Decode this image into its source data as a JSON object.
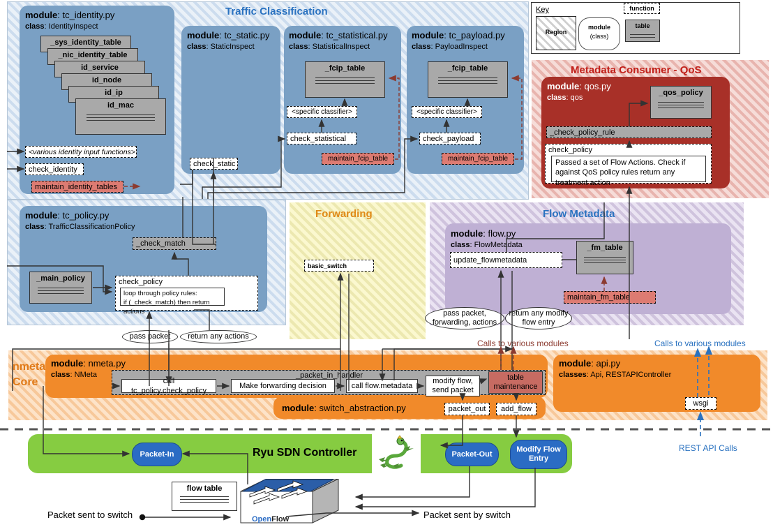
{
  "regions": {
    "traffic_classification": {
      "title": "Traffic Classification"
    },
    "qos": {
      "title": "Metadata Consumer - QoS"
    },
    "forwarding": {
      "title": "Forwarding"
    },
    "flow_metadata": {
      "title": "Flow Metadata"
    },
    "nmeta_core": {
      "title_line1": "nmeta",
      "title_line2": "Core"
    }
  },
  "key": {
    "label": "Key",
    "region": "Region",
    "module_line1": "module",
    "module_line2": "(class)",
    "function": "function",
    "table": "table"
  },
  "tc_identity": {
    "module_label": "module",
    "module_name": "tc_identity.py",
    "class_label": "class",
    "class_name": "IdentityInspect",
    "tables": [
      "_sys_identity_table",
      "_nic_identity_table",
      "id_service",
      "id_node",
      "id_ip",
      "id_mac"
    ],
    "functions": [
      "<various identity input functions>",
      "check_identity",
      "maintain_identity_tables"
    ]
  },
  "tc_static": {
    "module_label": "module",
    "module_name": "tc_static.py",
    "class_label": "class",
    "class_name": "StaticInspect",
    "functions": [
      "check_static"
    ]
  },
  "tc_statistical": {
    "module_label": "module",
    "module_name": "tc_statistical.py",
    "class_label": "class",
    "class_name": "StatisticalInspect",
    "table": "_fcip_table",
    "functions": [
      "<specific classifier>",
      "check_statistical",
      "maintain_fcip_table"
    ]
  },
  "tc_payload": {
    "module_label": "module",
    "module_name": "tc_payload.py",
    "class_label": "class",
    "class_name": "PayloadInspect",
    "table": "_fcip_table",
    "functions": [
      "<specific classifier>",
      "check_payload",
      "maintain_fcip_table"
    ]
  },
  "tc_policy": {
    "module_label": "module",
    "module_name": "tc_policy.py",
    "class_label": "class",
    "class_name": "TrafficClassificationPolicy",
    "table": "_main_policy",
    "check_match": "_check_match",
    "check_policy": "check_policy",
    "note_line1": "loop through policy rules:",
    "note_line2": "if (_check_match) then return actions"
  },
  "qos_module": {
    "module_label": "module",
    "module_name": "qos.py",
    "class_label": "class",
    "class_name": "qos",
    "table": "_qos_policy",
    "check_policy_rule": "_check_policy_rule",
    "check_policy": "check_policy",
    "note": "Passed a set of Flow Actions. Check if against QoS policy rules return any treatment action"
  },
  "forwarding_module": {
    "basic_switch": "basic_switch"
  },
  "flow_module": {
    "module_label": "module",
    "module_name": "flow.py",
    "class_label": "class",
    "class_name": "FlowMetadata",
    "table": "_fm_table",
    "functions": [
      "update_flowmetadata",
      "maintain_fm_table"
    ]
  },
  "nmeta_module": {
    "module_label": "module",
    "module_name": "nmeta.py",
    "class_label": "class",
    "class_name": "NMeta",
    "handler": "_packet_in_handler",
    "steps": [
      "call tc_policy.check_policy",
      "Make forwarding decision",
      "call flow.metadata",
      "modify flow, send packet"
    ],
    "table_maintenance_line1": "table",
    "table_maintenance_line2": "maintenance"
  },
  "switch_abstraction": {
    "module_label": "module",
    "module_name": "switch_abstraction.py",
    "functions": [
      "packet_out",
      "add_flow"
    ]
  },
  "api_module": {
    "module_label": "module",
    "module_name": "api.py",
    "classes_label": "classes",
    "classes_name": "Api, RESTAPIController",
    "wsgi": "wsgi"
  },
  "edge_labels": {
    "pass_packet": "pass packet",
    "return_any_actions": "return any actions",
    "pass_packet_forwarding": "pass packet, forwarding, actions",
    "return_modify_flow": "return any modify flow entry",
    "calls_various_red": "Calls to various modules",
    "calls_various_blue": "Calls to various modules",
    "rest_api_calls": "REST API Calls"
  },
  "ryu": {
    "title": "Ryu SDN Controller",
    "packet_in": "Packet-In",
    "packet_out": "Packet-Out",
    "modify_flow_entry": "Modify Flow Entry"
  },
  "switch": {
    "flow_table": "flow table",
    "openflow_open": "Open",
    "openflow_flow": "Flow",
    "packet_sent_to_switch": "Packet sent to switch",
    "packet_sent_by_switch": "Packet sent by switch"
  },
  "colors": {
    "tc_module": "#7aa0c4",
    "qos_module": "#a83028",
    "flow_module": "#bfb0d4",
    "core_module": "#f18a2a",
    "ryu_green": "#86cc41",
    "pill_blue": "#2b6cc4",
    "maintain_red": "#dd7b72",
    "table_gray": "#a9a9a9"
  }
}
